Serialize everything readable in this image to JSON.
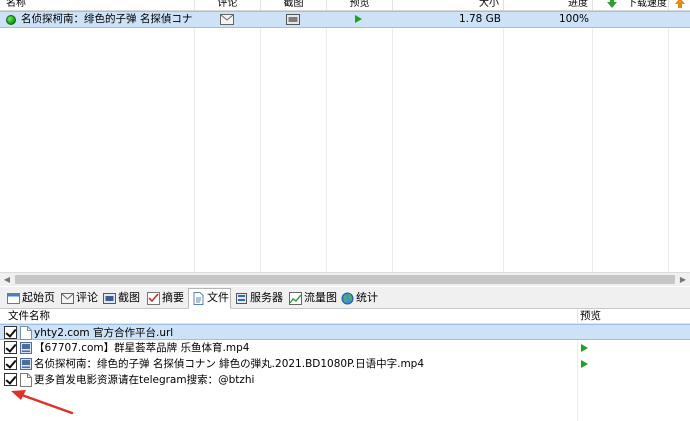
{
  "columns": {
    "name": "名称",
    "comments": "评论",
    "screenshot": "截图",
    "preview": "预览",
    "size": "大小",
    "progress": "进度",
    "download_speed": "下载速度"
  },
  "task": {
    "name": "名侦探柯南：绯色的子弹 名探偵コナン",
    "size": "1.78 GB",
    "progress": "100%"
  },
  "tabs": [
    {
      "label": "起始页"
    },
    {
      "label": "评论"
    },
    {
      "label": "截图"
    },
    {
      "label": "摘要"
    },
    {
      "label": "文件"
    },
    {
      "label": "服务器"
    },
    {
      "label": "流量图"
    },
    {
      "label": "统计"
    }
  ],
  "files_header": {
    "name": "文件名称",
    "preview": "预览"
  },
  "files": [
    {
      "name": "yhty2.com 官方合作平台.url",
      "icon": "url-file-icon",
      "selected": true,
      "preview": false,
      "checked": true
    },
    {
      "name": "【67707.com】群星荟萃品牌 乐鱼体育.mp4",
      "icon": "video-file-icon",
      "selected": false,
      "preview": true,
      "checked": true
    },
    {
      "name": "名侦探柯南：绯色的子弹 名探偵コナン 緋色の弾丸.2021.BD1080P.日语中字.mp4",
      "icon": "video-file-icon",
      "selected": false,
      "preview": true,
      "checked": true
    },
    {
      "name": "更多首发电影资源请在telegram搜索：@btzhi",
      "icon": "text-file-icon",
      "selected": false,
      "preview": false,
      "checked": true
    }
  ],
  "colors": {
    "selection": "#cde1f7",
    "annotation_arrow": "#e0302a",
    "play": "#1aa51a"
  }
}
